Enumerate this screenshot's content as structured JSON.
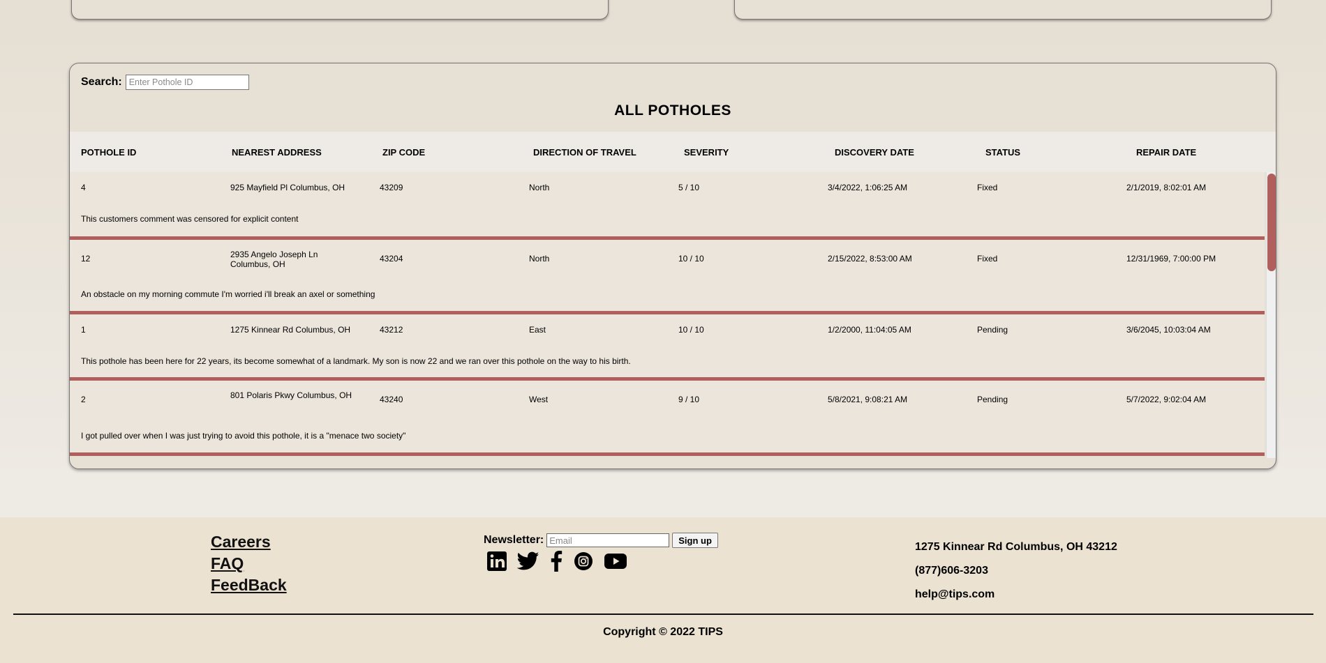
{
  "search": {
    "label": "Search:",
    "placeholder": "Enter Pothole ID"
  },
  "table": {
    "title": "ALL POTHOLES",
    "columns": [
      "POTHOLE ID",
      "NEAREST ADDRESS",
      "ZIP CODE",
      "DIRECTION OF TRAVEL",
      "SEVERITY",
      "DISCOVERY DATE",
      "STATUS",
      "REPAIR DATE"
    ],
    "rows": [
      {
        "id": "4",
        "address": "925 Mayfield Pl Columbus, OH",
        "zip": "43209",
        "direction": "North",
        "severity": "5 / 10",
        "discovery": "3/4/2022, 1:06:25 AM",
        "status": "Fixed",
        "repair": "2/1/2019, 8:02:01 AM",
        "comment": "This customers comment was censored for explicit content"
      },
      {
        "id": "12",
        "address": "2935 Angelo Joseph Ln Columbus, OH",
        "zip": "43204",
        "direction": "North",
        "severity": "10 / 10",
        "discovery": "2/15/2022, 8:53:00 AM",
        "status": "Fixed",
        "repair": "12/31/1969, 7:00:00 PM",
        "comment": "An obstacle on my morning commute I'm worried i'll break an axel or something"
      },
      {
        "id": "1",
        "address": "1275 Kinnear Rd Columbus, OH",
        "zip": "43212",
        "direction": "East",
        "severity": "10 / 10",
        "discovery": "1/2/2000, 11:04:05 AM",
        "status": "Pending",
        "repair": "3/6/2045, 10:03:04 AM",
        "comment": "This pothole has been here for 22 years, its become somewhat of a landmark. My son is now 22 and we ran over this pothole on the way to his birth."
      },
      {
        "id": "2",
        "address": "801 Polaris Pkwy Columbus, OH",
        "zip": "43240",
        "direction": "West",
        "severity": "9 / 10",
        "discovery": "5/8/2021, 9:08:21 AM",
        "status": "Pending",
        "repair": "5/7/2022, 9:02:04 AM",
        "comment": "I got pulled over when I was just trying to avoid this pothole, it is a \"menace two society\""
      }
    ]
  },
  "footer": {
    "links": [
      "Careers",
      "FAQ",
      "FeedBack"
    ],
    "newsletter": {
      "label": "Newsletter:",
      "placeholder": "Email",
      "button": "Sign up"
    },
    "socials": [
      "linkedin-icon",
      "twitter-icon",
      "facebook-icon",
      "instagram-icon",
      "youtube-icon"
    ],
    "address": "1275 Kinnear Rd Columbus, OH 43212",
    "phone": "(877)606-3203",
    "email": "help@tips.com",
    "copyright": "Copyright © 2022 TIPS"
  },
  "colors": {
    "accent": "#b15f5d",
    "page_bg": "#e6dfd3",
    "footer_bg": "#ebe2d2"
  }
}
